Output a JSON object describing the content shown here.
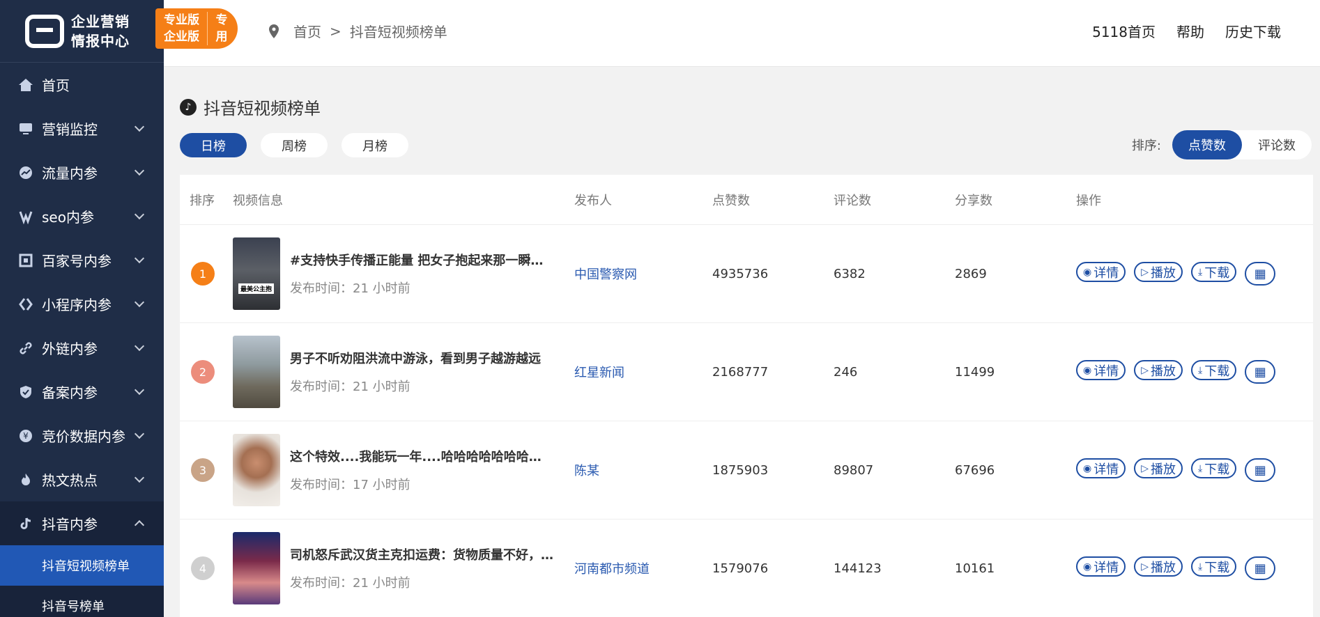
{
  "brand": {
    "line1": "企业营销",
    "line2": "情报中心"
  },
  "badge": {
    "line1": "专业版",
    "line2": "企业版",
    "right1": "专",
    "right2": "用"
  },
  "sidebar": {
    "items": [
      {
        "label": "首页",
        "icon": "home-icon"
      },
      {
        "label": "营销监控",
        "icon": "monitor-icon"
      },
      {
        "label": "流量内参",
        "icon": "trend-icon"
      },
      {
        "label": "seo内参",
        "icon": "seo-icon"
      },
      {
        "label": "百家号内参",
        "icon": "baijiahao-icon"
      },
      {
        "label": "小程序内参",
        "icon": "miniapp-icon"
      },
      {
        "label": "外链内参",
        "icon": "link-icon"
      },
      {
        "label": "备案内参",
        "icon": "shield-icon"
      },
      {
        "label": "竞价数据内参",
        "icon": "yen-icon"
      },
      {
        "label": "热文热点",
        "icon": "fire-icon"
      },
      {
        "label": "抖音内参",
        "icon": "douyin-icon"
      }
    ],
    "sub_items": [
      {
        "label": "抖音短视频榜单"
      },
      {
        "label": "抖音号榜单"
      }
    ]
  },
  "breadcrumb": {
    "home": "首页",
    "sep": ">",
    "current": "抖音短视频榜单"
  },
  "top_links": {
    "home": "5118首页",
    "help": "帮助",
    "history": "历史下载"
  },
  "page": {
    "title": "抖音短视频榜单"
  },
  "tabs": [
    "日榜",
    "周榜",
    "月榜"
  ],
  "sort": {
    "label": "排序:",
    "options": [
      "点赞数",
      "评论数"
    ]
  },
  "table": {
    "headers": [
      "排序",
      "视频信息",
      "发布人",
      "点赞数",
      "评论数",
      "分享数",
      "操作"
    ],
    "ops": {
      "detail": "详情",
      "play": "播放",
      "download": "下载"
    },
    "rows": [
      {
        "rank": "1",
        "title": "#支持快手传播正能量 把女子抱起来那一瞬间，全场欢呼",
        "time": "发布时间：21 小时前",
        "publisher": "中国警察网",
        "likes": "4935736",
        "comments": "6382",
        "shares": "2869",
        "thumb_tag": "最美公主抱"
      },
      {
        "rank": "2",
        "title": "男子不听劝阻洪流中游泳，看到男子越游越远",
        "time": "发布时间：21 小时前",
        "publisher": "红星新闻",
        "likes": "2168777",
        "comments": "246",
        "shares": "11499"
      },
      {
        "rank": "3",
        "title": "这个特效....我能玩一年....哈哈哈哈哈哈哈哈哈",
        "time": "发布时间：17 小时前",
        "publisher": "陈某",
        "likes": "1875903",
        "comments": "89807",
        "shares": "67696"
      },
      {
        "rank": "4",
        "title": "司机怒斥武汉货主克扣运费：货物质量不好，却扣我的钱",
        "time": "发布时间：21 小时前",
        "publisher": "河南都市频道",
        "likes": "1579076",
        "comments": "144123",
        "shares": "10161"
      }
    ]
  },
  "colors": {
    "sidebar_bg": "#1f2d47",
    "accent": "#1e4ea3",
    "badge": "#f57f17",
    "rank1": "#f57f17",
    "rank2": "#ec8d7c",
    "rank3": "#c9a487",
    "rank4": "#cfcfcf"
  }
}
